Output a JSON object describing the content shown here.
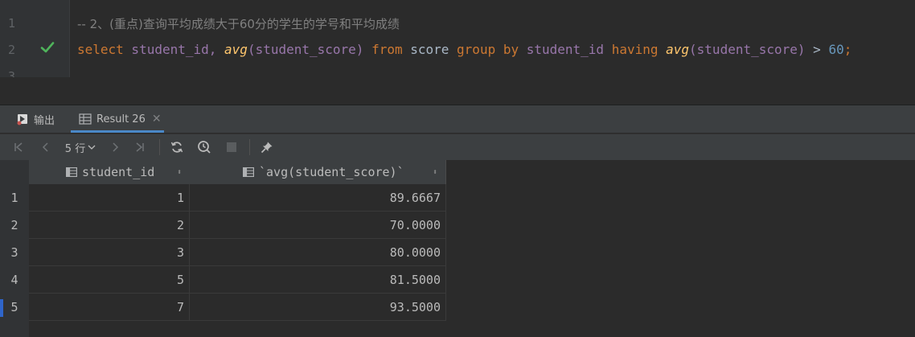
{
  "editor": {
    "line_numbers": [
      "1",
      "2",
      "3"
    ],
    "line1_comment": "-- 2、(重点)查询平均成绩大于60分的学生的学号和平均成绩",
    "line2": {
      "t1": "select",
      "t2": " student_id, ",
      "t3": "avg",
      "t4": "(student_score)",
      "t5": " from ",
      "t6": "score",
      "t7": " group by ",
      "t8": "student_id",
      "t9": " having ",
      "t10": "avg",
      "t11": "(student_score)",
      "t12": " > ",
      "t13": "60",
      "t14": ";"
    }
  },
  "tabs": {
    "output_label": "输出",
    "result_label": "Result 26"
  },
  "toolbar": {
    "page_size": "5 行"
  },
  "grid": {
    "columns": [
      "student_id",
      "`avg(student_score)`"
    ],
    "row_numbers": [
      "1",
      "2",
      "3",
      "4",
      "5"
    ],
    "rows": [
      [
        "1",
        "89.6667"
      ],
      [
        "2",
        "70.0000"
      ],
      [
        "3",
        "80.0000"
      ],
      [
        "5",
        "81.5000"
      ],
      [
        "7",
        "93.5000"
      ]
    ]
  },
  "colors": {
    "keyword": "#cc7832",
    "function": "#ffc66d",
    "identifier": "#9876aa",
    "number": "#6897bb",
    "check": "#4fb35b"
  }
}
